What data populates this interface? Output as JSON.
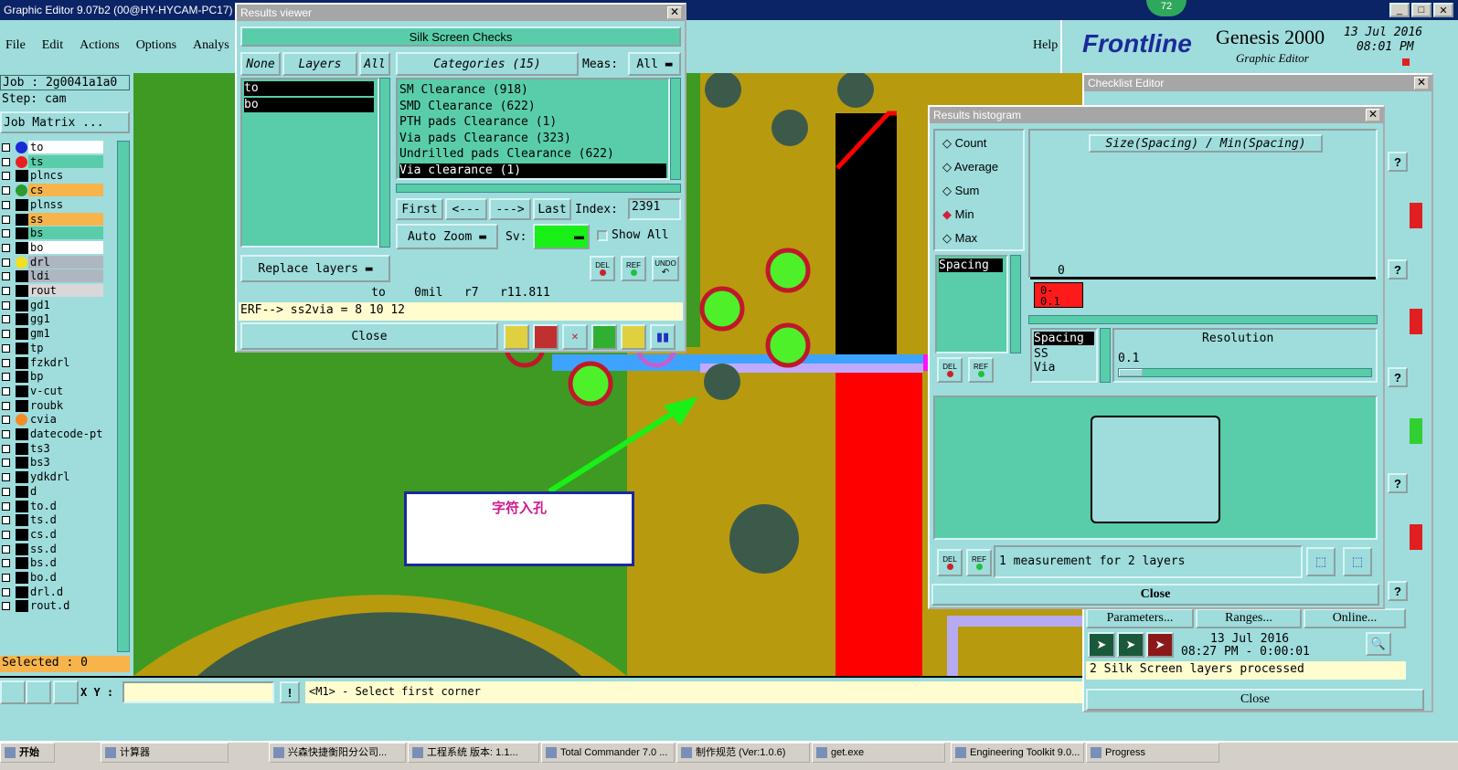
{
  "main_window": {
    "title": "Graphic Editor 9.07b2 (00@HY-HYCAM-PC17)",
    "menu": [
      "File",
      "Edit",
      "Actions",
      "Options",
      "Analys"
    ],
    "help": "Help",
    "brand": "Frontline",
    "product": "Genesis 2000",
    "product_sub": "Graphic Editor",
    "date": "13 Jul 2016",
    "time": "08:01 PM",
    "badge": "72"
  },
  "job": {
    "job_label": "Job : 2g0041a1a0",
    "step_label": "Step: cam",
    "matrix_button": "Job Matrix ...",
    "selected": "Selected : 0"
  },
  "layers": [
    {
      "name": "to",
      "dot": "#1a2ad8",
      "hl": "#ffffff"
    },
    {
      "name": "ts",
      "dot": "#e82020",
      "hl": "#59cda9"
    },
    {
      "name": "plncs",
      "dot": "",
      "hl": ""
    },
    {
      "name": "cs",
      "dot": "#2e9a2e",
      "hl": "#f6b44b"
    },
    {
      "name": "plnss",
      "dot": "",
      "hl": ""
    },
    {
      "name": "ss",
      "dot": "",
      "hl": "#f6b44b"
    },
    {
      "name": "bs",
      "dot": "",
      "hl": "#59cda9"
    },
    {
      "name": "bo",
      "dot": "",
      "hl": "#ffffff"
    },
    {
      "name": "drl",
      "dot": "#f0e020",
      "hl": "#aeb6c0"
    },
    {
      "name": "ldi",
      "dot": "",
      "hl": "#aeb6c0"
    },
    {
      "name": "rout",
      "dot": "",
      "hl": "#d8d8d8"
    },
    {
      "name": "gd1",
      "dot": "",
      "hl": ""
    },
    {
      "name": "gg1",
      "dot": "",
      "hl": ""
    },
    {
      "name": "gm1",
      "dot": "",
      "hl": ""
    },
    {
      "name": "tp",
      "dot": "",
      "hl": ""
    },
    {
      "name": "fzkdrl",
      "dot": "",
      "hl": ""
    },
    {
      "name": "bp",
      "dot": "",
      "hl": ""
    },
    {
      "name": "v-cut",
      "dot": "",
      "hl": ""
    },
    {
      "name": "roubk",
      "dot": "",
      "hl": ""
    },
    {
      "name": "cvia",
      "dot": "#f28c28",
      "hl": ""
    },
    {
      "name": "datecode-pt",
      "dot": "",
      "hl": ""
    },
    {
      "name": "ts3",
      "dot": "",
      "hl": ""
    },
    {
      "name": "bs3",
      "dot": "",
      "hl": ""
    },
    {
      "name": "ydkdrl",
      "dot": "",
      "hl": ""
    },
    {
      "name": "d",
      "dot": "",
      "hl": ""
    },
    {
      "name": "to.d",
      "dot": "",
      "hl": ""
    },
    {
      "name": "ts.d",
      "dot": "",
      "hl": ""
    },
    {
      "name": "cs.d",
      "dot": "",
      "hl": ""
    },
    {
      "name": "ss.d",
      "dot": "",
      "hl": ""
    },
    {
      "name": "bs.d",
      "dot": "",
      "hl": ""
    },
    {
      "name": "bo.d",
      "dot": "",
      "hl": ""
    },
    {
      "name": "drl.d",
      "dot": "",
      "hl": ""
    },
    {
      "name": "rout.d",
      "dot": "",
      "hl": ""
    }
  ],
  "canvas": {
    "annotation": "字符入孔"
  },
  "bottom": {
    "xy_label": "X Y :",
    "status": "<M1> - Select first corner"
  },
  "results_viewer": {
    "title": "Results viewer",
    "header": "Silk Screen Checks",
    "none_btn": "None",
    "layers_btn": "Layers",
    "all_btn": "All",
    "categories_label": "Categories (15)",
    "meas_label": "Meas:",
    "meas_value": "All",
    "layers": [
      "to",
      "bo"
    ],
    "categories": [
      "SM Clearance (918)",
      "SMD Clearance (622)",
      "PTH pads Clearance (1)",
      "Via pads Clearance (323)",
      "Undrilled pads Clearance (622)",
      "Via clearance (1)"
    ],
    "first": "First",
    "prev": "<---",
    "next": "--->",
    "last": "Last",
    "index_label": "Index:",
    "index_value": "2391",
    "auto_zoom": "Auto Zoom",
    "sv_label": "Sv:",
    "show_all": "Show All",
    "replace_layers": "Replace layers",
    "del": "DEL",
    "ref": "REF",
    "undo": "UNDO",
    "info": "to    0mil   r7   r11.811",
    "erf": "ERF--> ss2via = 8 10 12",
    "close": "Close"
  },
  "histogram": {
    "title": "Results histogram",
    "options": [
      "Count",
      "Average",
      "Sum",
      "Min",
      "Max"
    ],
    "selected_option": "Min",
    "chart_title": "Size(Spacing) / Min(Spacing)",
    "axis_zero": "0",
    "bar_label": "0-\n0.1",
    "list1": [
      "Spacing"
    ],
    "list2": [
      "Spacing",
      "SS",
      "Via"
    ],
    "resolution_label": "Resolution",
    "resolution_value": "0.1",
    "summary": "1 measurement for 2 layers",
    "close": "Close",
    "del": "DEL",
    "ref": "REF"
  },
  "checklist": {
    "title": "Checklist Editor",
    "parameters": "Parameters...",
    "ranges": "Ranges...",
    "online": "Online...",
    "date": "13 Jul 2016",
    "time": "08:27 PM - 0:00:01",
    "processed": "2 Silk Screen layers processed",
    "close": "Close"
  },
  "taskbar": [
    {
      "label": "开始"
    },
    {
      "label": "计算器"
    },
    {
      "label": "兴森快捷衡阳分公司..."
    },
    {
      "label": "工程系统  版本: 1.1..."
    },
    {
      "label": "Total Commander 7.0 ..."
    },
    {
      "label": "制作规范 (Ver:1.0.6)"
    },
    {
      "label": "get.exe"
    },
    {
      "label": "Engineering Toolkit 9.0..."
    },
    {
      "label": "Progress"
    }
  ]
}
